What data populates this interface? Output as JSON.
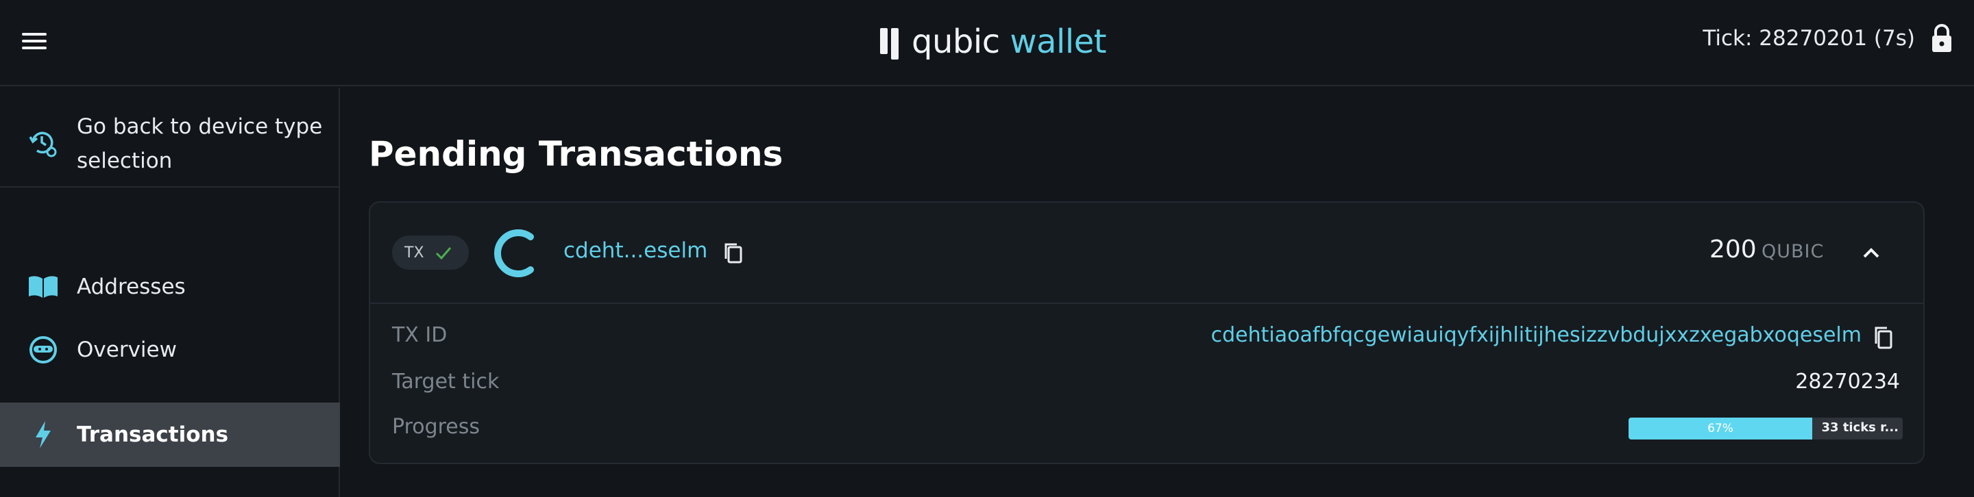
{
  "header": {
    "logo_primary": "qubic",
    "logo_secondary": "wallet",
    "tick_text": "Tick: 28270201 (7s)"
  },
  "sidebar": {
    "items": [
      {
        "label": "Go back to device type selection",
        "icon": "device-reset-icon"
      },
      {
        "label": "Addresses",
        "icon": "book-icon"
      },
      {
        "label": "Overview",
        "icon": "face-icon"
      },
      {
        "label": "Transactions",
        "icon": "bolt-icon",
        "active": true
      }
    ]
  },
  "main": {
    "title": "Pending Transactions",
    "transaction": {
      "badge": "TX",
      "short_id": "cdeht...eselm",
      "amount": "200",
      "unit": "QUBIC",
      "rows": {
        "tx_id_label": "TX ID",
        "tx_id_value": "cdehtiaoafbfqcgewiauiqyfxijhlitijhesizzvbdujxxzxegabxoqeselm",
        "target_tick_label": "Target tick",
        "target_tick_value": "28270234",
        "progress_label": "Progress",
        "progress_percent_text": "67%",
        "progress_fraction": 0.67,
        "progress_remaining_text": "33 ticks r..."
      }
    }
  },
  "colors": {
    "accent": "#5fcfe7",
    "background": "#121519",
    "active_item": "#3d4148",
    "success": "#4caf50"
  }
}
